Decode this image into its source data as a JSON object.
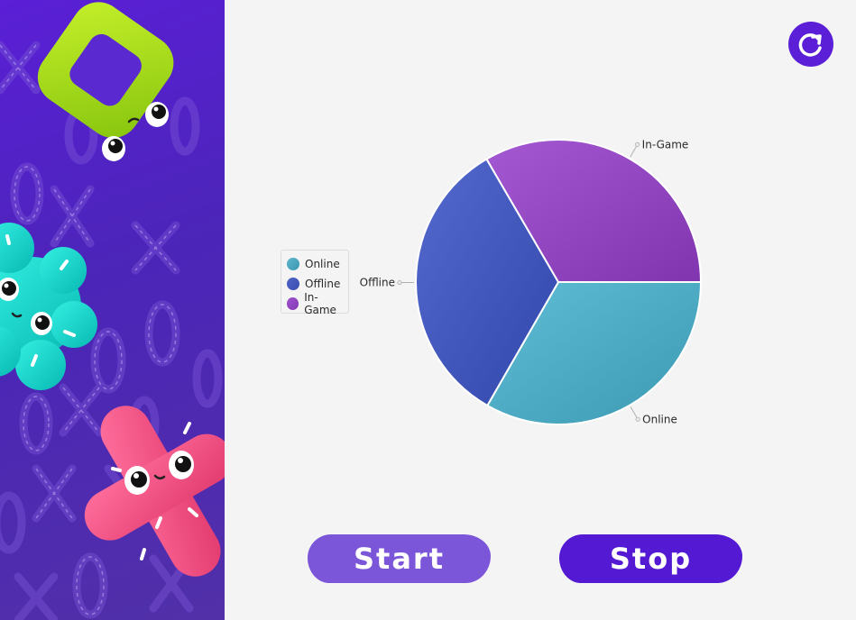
{
  "controls": {
    "start_label": "Start",
    "stop_label": "Stop",
    "refresh_icon": "refresh-icon"
  },
  "colors": {
    "sidebar": "#5a1fd6",
    "online": "#4aa7c0",
    "offline": "#3f54b8",
    "in_game": "#8e43bd",
    "start_button": "#7c56d8",
    "stop_button": "#5319d3"
  },
  "chart_data": {
    "type": "pie",
    "title": "",
    "legend_position": "left",
    "slices": [
      {
        "label": "Online",
        "value": 33.3,
        "color": "#4aa7c0"
      },
      {
        "label": "Offline",
        "value": 33.3,
        "color": "#3f54b8"
      },
      {
        "label": "In-Game",
        "value": 33.4,
        "color": "#8e43bd"
      }
    ]
  },
  "legend": {
    "items": [
      {
        "label": "Online"
      },
      {
        "label": "Offline"
      },
      {
        "label": "In-Game"
      }
    ]
  }
}
